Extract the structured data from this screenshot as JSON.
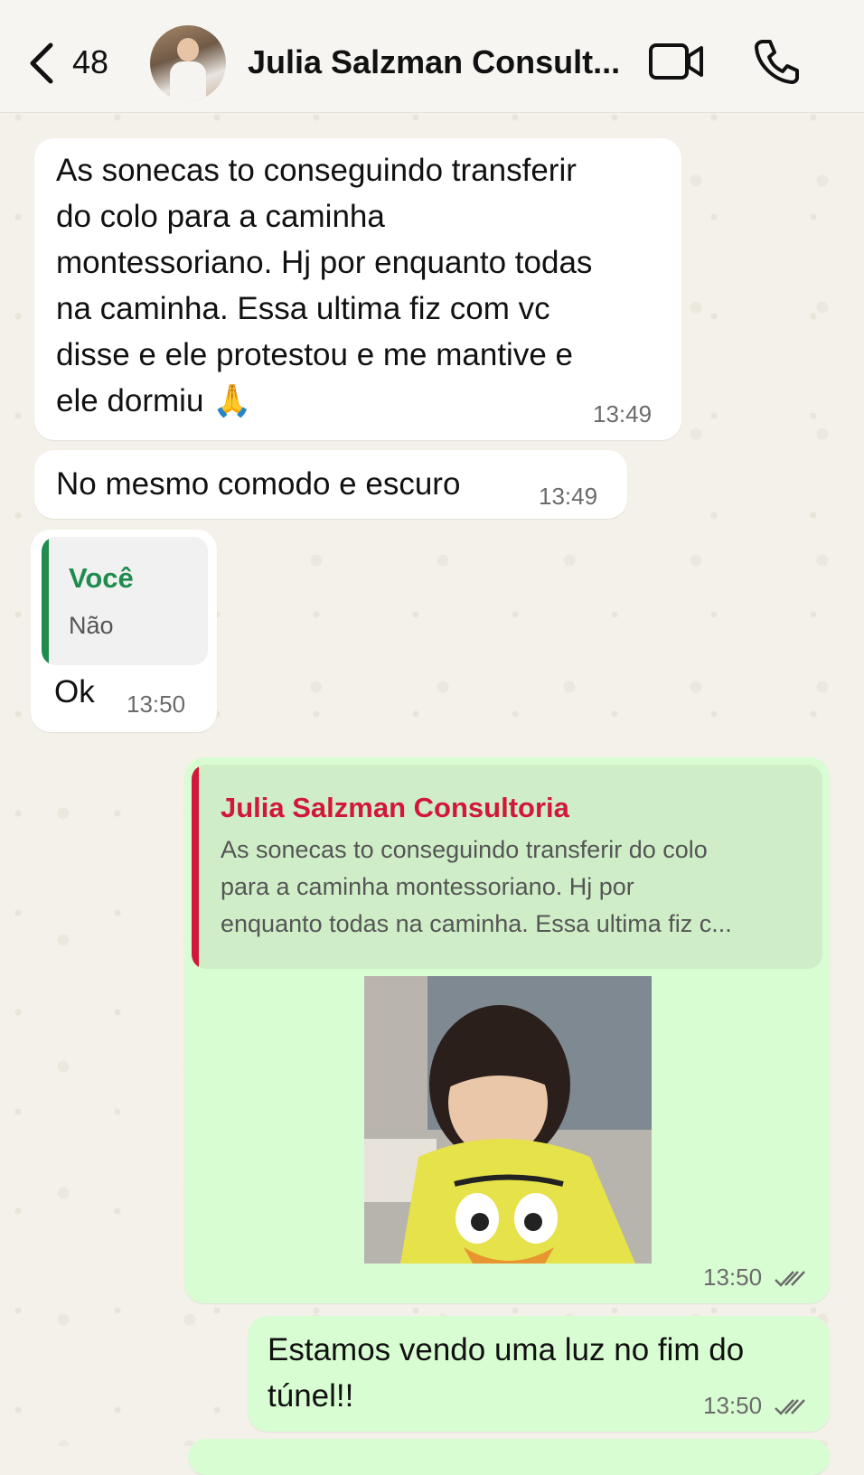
{
  "header": {
    "unread_count": "48",
    "contact_name": "Julia Salzman Consult..."
  },
  "messages": [
    {
      "direction": "incoming",
      "lines": [
        "As sonecas to conseguindo transferir",
        "do colo para a caminha",
        "montessoriano. Hj por enquanto todas",
        "na caminha. Essa ultima fiz com vc",
        "disse e ele protestou e me mantive e",
        "ele dormiu 🙏"
      ],
      "time": "13:49"
    },
    {
      "direction": "incoming",
      "text": "No mesmo comodo e escuro",
      "time": "13:49"
    },
    {
      "direction": "incoming",
      "quote_author": "Você",
      "quote_text": "Não",
      "text": "Ok",
      "time": "13:50"
    },
    {
      "direction": "outgoing",
      "quote_author": "Julia Salzman Consultoria",
      "quote_lines": [
        "As sonecas to conseguindo transferir do colo",
        "para a caminha montessoriano. Hj por",
        "enquanto todas na caminha. Essa ultima fiz c..."
      ],
      "media": "gif",
      "time": "13:50"
    },
    {
      "direction": "outgoing",
      "lines": [
        "Estamos vendo uma luz no fim do",
        "túnel!!"
      ],
      "time": "13:50"
    }
  ],
  "colors": {
    "incoming_bubble": "#ffffff",
    "outgoing_bubble": "#d9fdd3",
    "quote_self": "#1f8c4e",
    "quote_contact": "#d1183a",
    "background": "#f4f1ea",
    "read_ticks": "#6b6b6b"
  },
  "icons": [
    "back-chevron-icon",
    "video-call-icon",
    "phone-icon",
    "double-check-icon"
  ]
}
